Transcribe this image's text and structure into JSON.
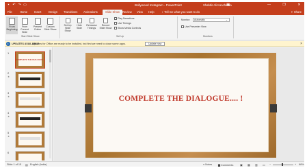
{
  "titlebar": {
    "qat_icons": [
      "save-icon",
      "undo-icon",
      "redo-icon",
      "present-icon"
    ],
    "doc_title": "Bollywood Instagram - PowerPoint",
    "user": "Shabbir Ali Kanchwala",
    "window_buttons": [
      "—",
      "❐",
      "✕"
    ]
  },
  "tabs": {
    "items": [
      "File",
      "Home",
      "Insert",
      "Design",
      "Transitions",
      "Animations",
      "Slide Show",
      "Review",
      "View",
      "Help"
    ],
    "active": "Slide Show",
    "tell_me": "Tell me what you want to do",
    "share": "Share"
  },
  "ribbon": {
    "buttons": {
      "from_beginning": "From Beginning",
      "from_current": "From Current Slide",
      "present_online": "Present Online",
      "custom_show": "Custom Slide Show",
      "setup": "Set Up Slide Show",
      "hide": "Hide Slide",
      "rehearse": "Rehearse Timings",
      "record": "Record Slide Show"
    },
    "checks": {
      "play_narrations": "Play Narrations",
      "use_timings": "Use Timings",
      "show_media": "Show Media Controls",
      "presenter_view": "Use Presenter View"
    },
    "monitor_label": "Monitor:",
    "monitor_value": "Automatic",
    "groups": {
      "start": "Start Slide Show",
      "setup": "Set Up",
      "monitors": "Monitors"
    }
  },
  "update_bar": {
    "title": "UPDATES AVAILABLE",
    "text": "Updates for Office are ready to be installed, but first we need to close some apps.",
    "button": "Update now"
  },
  "thumbnails": {
    "numbers": [
      "1",
      "2",
      "3",
      "4",
      "5",
      "6"
    ],
    "slide1_text": "COMPLETE THE DIALOGUE.... !"
  },
  "slide": {
    "title": "COMPLETE THE DIALOGUE.... !"
  },
  "status": {
    "slide_info": "Slide 1 of 15",
    "language": "English (India)",
    "notes": "Notes",
    "comments": "Comments",
    "zoom": "68%"
  }
}
